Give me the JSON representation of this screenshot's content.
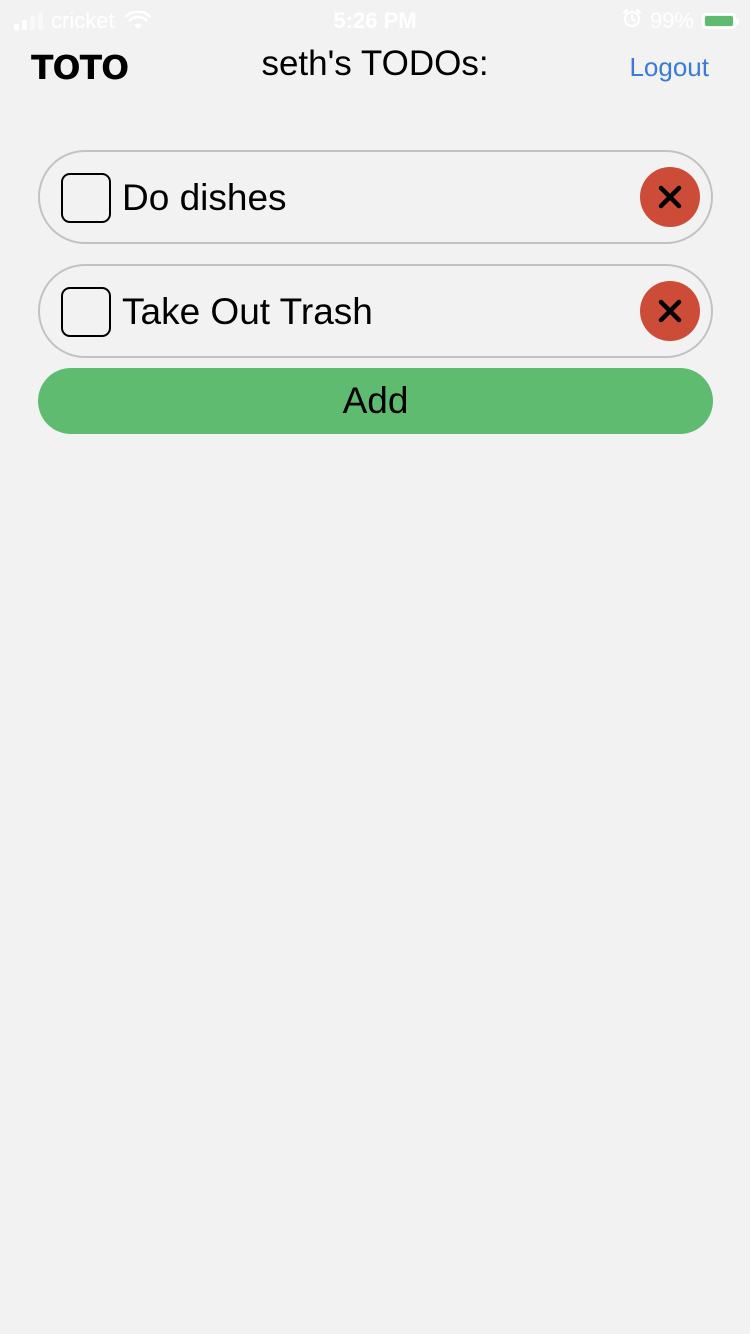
{
  "status_bar": {
    "carrier": "cricket",
    "time": "5:26 PM",
    "battery_percent": "99%",
    "battery_level": 0.99,
    "icons": [
      "signal-icon",
      "wifi-icon",
      "alarm-icon",
      "battery-icon"
    ]
  },
  "header": {
    "logo": "TOTO",
    "title": "seth's TODOs:",
    "logout_label": "Logout"
  },
  "todos": [
    {
      "label": "Do dishes",
      "checked": false
    },
    {
      "label": "Take Out Trash",
      "checked": false
    }
  ],
  "add_label": "Add",
  "colors": {
    "background": "#f2f2f2",
    "link": "#3a7bd5",
    "delete": "#cc4c38",
    "add": "#5fbb6f",
    "border": "#c2c2c2"
  }
}
